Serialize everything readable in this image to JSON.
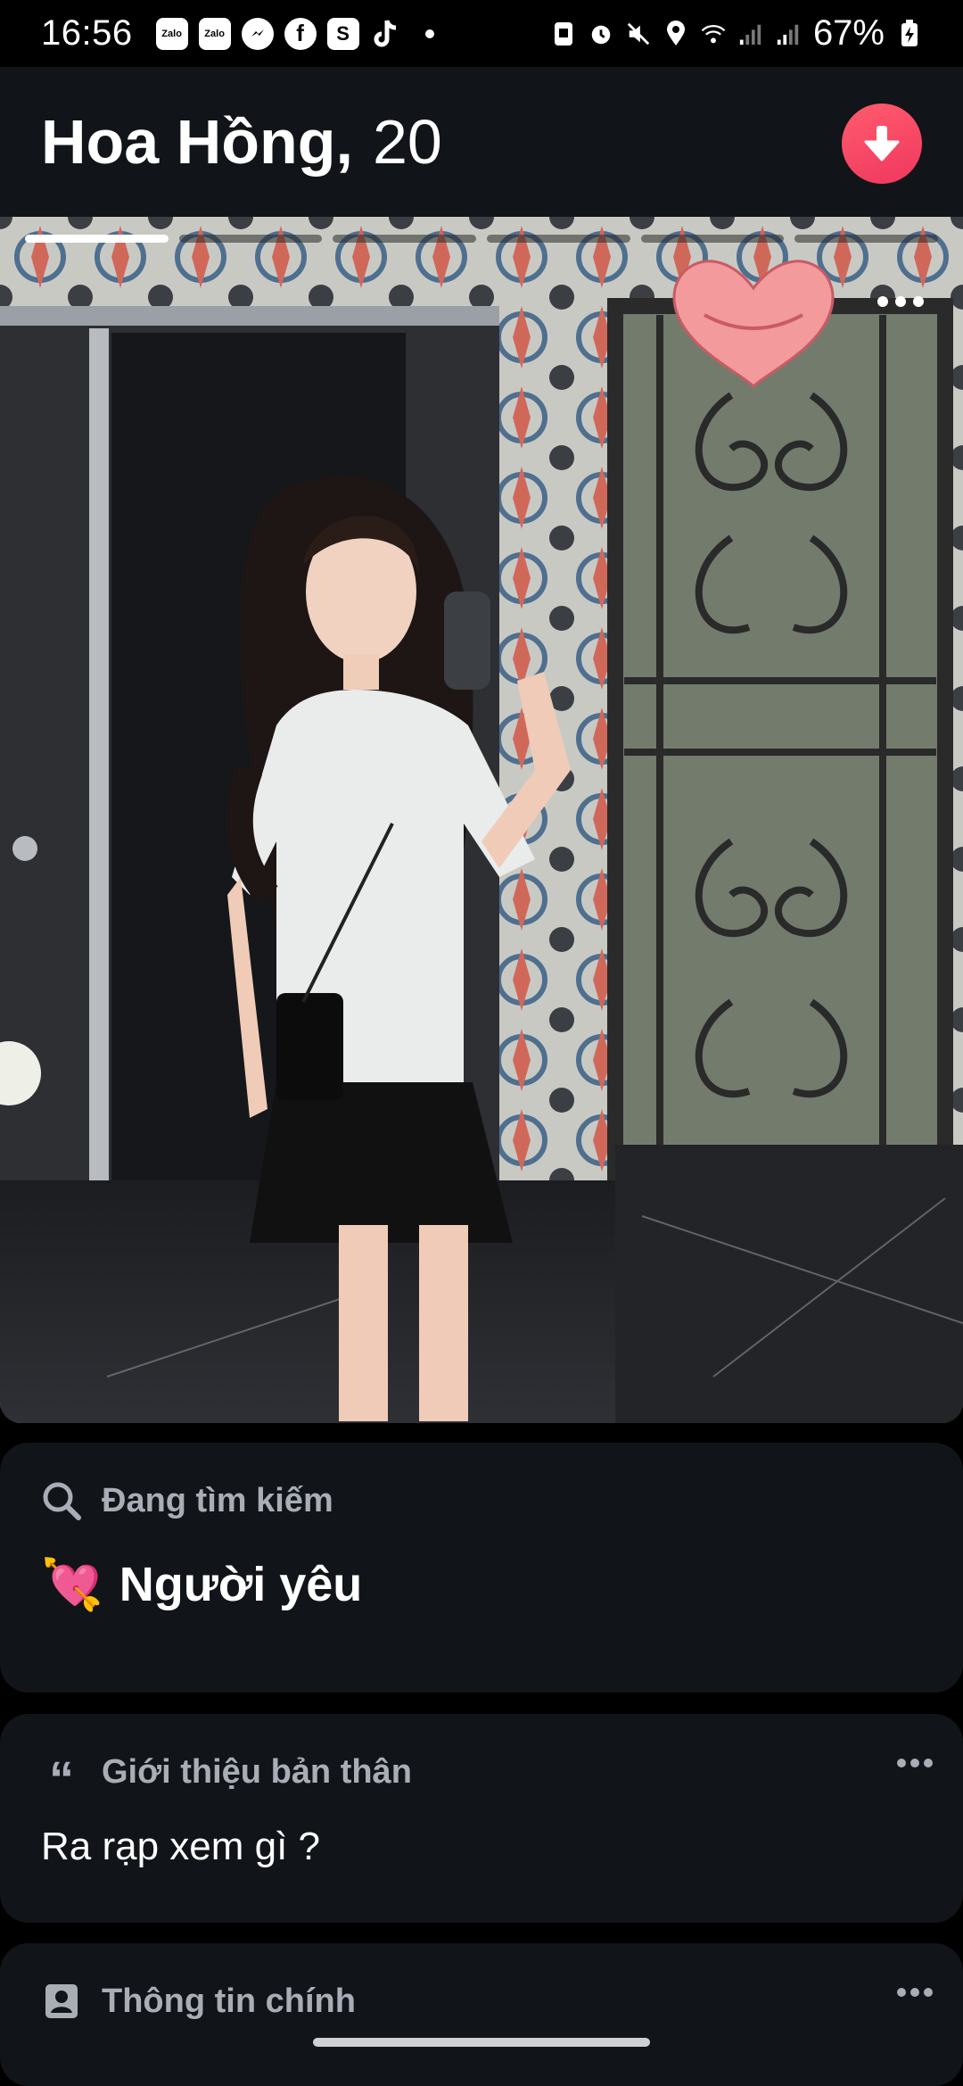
{
  "status_bar": {
    "time": "16:56",
    "app_icons": [
      "zalo-icon",
      "zalo-icon",
      "messenger-icon",
      "facebook-icon",
      "shopee-icon",
      "tiktok-icon"
    ],
    "battery_percent": "67%"
  },
  "profile": {
    "name": "Hoa Hồng,",
    "age": "20"
  },
  "photo": {
    "photo_count": 6,
    "active_index": 0
  },
  "looking_for": {
    "label": "Đang tìm kiếm",
    "emoji": "💘",
    "value": "Người yêu"
  },
  "about": {
    "label": "Giới thiệu bản thân",
    "text": "Ra rạp xem gì ?"
  },
  "basics": {
    "label": "Thông tin chính"
  },
  "colors": {
    "background": "#000000",
    "card": "#111418",
    "accent": "#f03760",
    "muted": "#a8adb6"
  }
}
